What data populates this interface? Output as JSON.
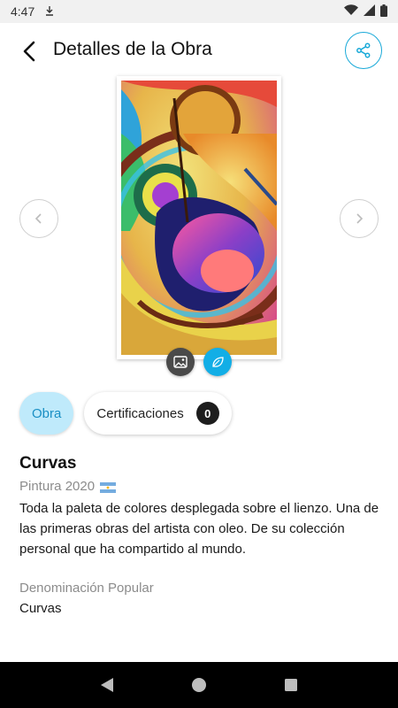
{
  "status_bar": {
    "time": "4:47"
  },
  "header": {
    "title": "Detalles de la Obra"
  },
  "tabs": {
    "obra_label": "Obra",
    "cert_label": "Certificaciones",
    "cert_count": "0"
  },
  "work": {
    "title": "Curvas",
    "meta": "Pintura 2020",
    "country_flag": "argentina-flag-icon",
    "description": "Toda la paleta de colores desplegada sobre el lienzo. Una de las primeras obras del artista con oleo. De su colección personal que ha compartido al mundo.",
    "popular_name_label": "Denominación Popular",
    "popular_name": "Curvas"
  },
  "colors": {
    "accent": "#12aee6",
    "tab_active_bg": "#bfeafb",
    "muted_text": "#8c8c8c"
  }
}
